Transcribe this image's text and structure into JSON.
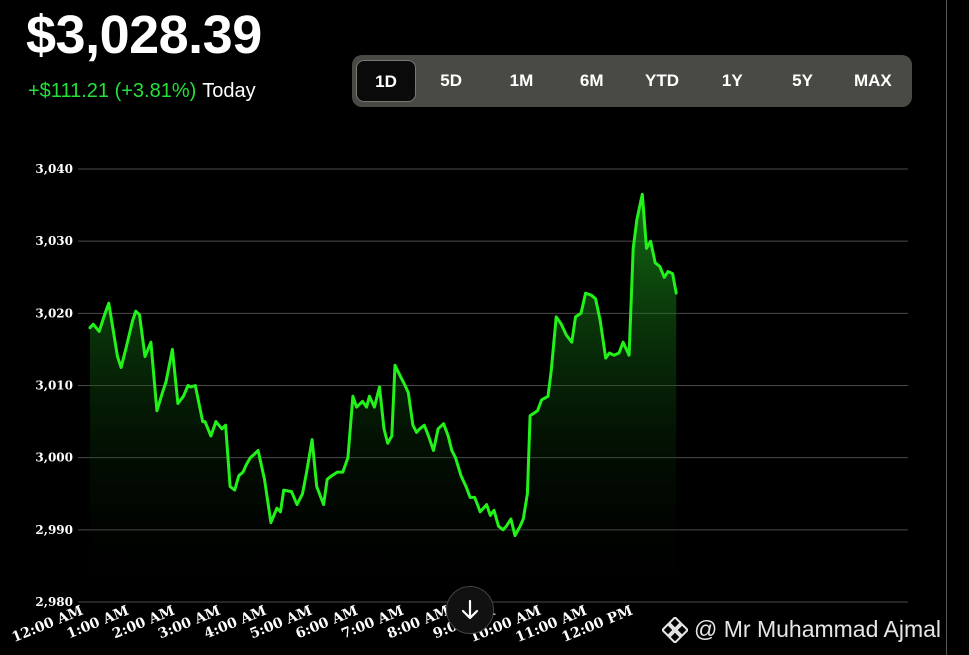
{
  "header": {
    "price": "$3,028.39",
    "change": "+$111.21 (+3.81%)",
    "period_label": "Today"
  },
  "ranges": [
    "1D",
    "5D",
    "1M",
    "6M",
    "YTD",
    "1Y",
    "5Y",
    "MAX"
  ],
  "active_range": "1D",
  "watermark": "@ Mr Muhammad Ajmal",
  "colors": {
    "line": "#22f21a",
    "up": "#22e13a",
    "background": "#000000"
  },
  "icons": {
    "scroll": "arrow-down-icon",
    "brand": "diamond-logo-icon"
  },
  "chart_data": {
    "type": "area",
    "title": "",
    "xlabel": "",
    "ylabel": "",
    "ylim": [
      2980,
      3040
    ],
    "yticks": [
      2980,
      2990,
      3000,
      3010,
      3020,
      3030,
      3040
    ],
    "ytick_labels": [
      "2,980",
      "2,990",
      "3,000",
      "3,010",
      "3,020",
      "3,030",
      "3,040"
    ],
    "xticks": [
      0,
      1,
      2,
      3,
      4,
      5,
      6,
      7,
      8,
      9,
      10,
      11,
      12
    ],
    "xtick_labels": [
      "12:00 AM",
      "1:00 AM",
      "2:00 AM",
      "3:00 AM",
      "4:00 AM",
      "5:00 AM",
      "6:00 AM",
      "7:00 AM",
      "8:00 AM",
      "9:00 AM",
      "10:00 AM",
      "11:00 AM",
      "12:00 PM"
    ],
    "xlim": [
      0,
      12.8
    ],
    "grid": true,
    "series": [
      {
        "x": [
          0,
          0.07,
          0.2,
          0.33,
          0.41,
          0.6,
          0.68,
          0.8,
          0.93,
          1.0,
          1.08,
          1.2,
          1.33,
          1.46,
          1.58,
          1.66,
          1.8,
          1.92,
          2.04,
          2.14,
          2.2,
          2.3,
          2.46,
          2.51,
          2.64,
          2.75,
          2.88,
          2.96,
          3.06,
          3.16,
          3.25,
          3.34,
          3.41,
          3.5,
          3.59,
          3.67,
          3.81,
          3.95,
          4.08,
          4.16,
          4.23,
          4.4,
          4.52,
          4.64,
          4.73,
          4.85,
          4.95,
          5.1,
          5.18,
          5.28,
          5.4,
          5.52,
          5.63,
          5.74,
          5.82,
          5.95,
          6.04,
          6.1,
          6.21,
          6.32,
          6.42,
          6.5,
          6.59,
          6.66,
          6.8,
          6.88,
          6.95,
          7.05,
          7.13,
          7.2,
          7.3,
          7.39,
          7.5,
          7.6,
          7.72,
          7.82,
          7.9,
          7.98,
          8.1,
          8.21,
          8.3,
          8.4,
          8.52,
          8.66,
          8.74,
          8.82,
          8.92,
          9.02,
          9.09,
          9.19,
          9.28,
          9.39,
          9.46,
          9.55,
          9.61,
          9.77,
          9.86,
          10.0,
          10.07,
          10.18,
          10.29,
          10.4,
          10.52,
          10.6,
          10.72,
          10.82,
          10.95,
          11.04,
          11.14,
          11.26,
          11.34,
          11.44,
          11.55,
          11.64,
          11.77,
          11.86,
          11.94,
          12.06,
          12.15,
          12.24,
          12.34,
          12.44,
          12.54,
          12.62,
          12.72,
          12.8
        ],
        "y": [
          3018.0,
          3018.5,
          3017.5,
          3020.0,
          3021.4,
          3014.0,
          3012.5,
          3015.5,
          3019.0,
          3020.3,
          3019.8,
          3014.0,
          3016.0,
          3006.5,
          3009.0,
          3010.5,
          3015.0,
          3007.5,
          3008.5,
          3010.0,
          3009.8,
          3010.0,
          3005.0,
          3005.0,
          3003.0,
          3005.0,
          3004.0,
          3004.5,
          2996.0,
          2995.5,
          2997.5,
          2998.0,
          2999.0,
          3000.0,
          3000.5,
          3001.0,
          2997.0,
          2991.0,
          2993.0,
          2992.5,
          2995.5,
          2995.3,
          2993.5,
          2995.0,
          2998.0,
          3002.5,
          2996.0,
          2993.5,
          2997.0,
          2997.5,
          2998.0,
          2998.0,
          3000.0,
          3008.5,
          3007.0,
          3007.8,
          3007.0,
          3008.5,
          3007.0,
          3009.8,
          3004.0,
          3002.0,
          3003.0,
          3012.8,
          3011.0,
          3010.0,
          3009.0,
          3004.5,
          3003.5,
          3004.0,
          3004.5,
          3003.0,
          3001.0,
          3004.0,
          3004.7,
          3003.0,
          3001.0,
          3000.0,
          2997.5,
          2996.0,
          2994.5,
          2994.5,
          2992.5,
          2993.5,
          2992.0,
          2992.7,
          2990.5,
          2990.0,
          2990.5,
          2991.5,
          2989.2,
          2990.5,
          2991.5,
          2995.0,
          3005.8,
          3006.5,
          3008.0,
          3008.5,
          3012.0,
          3019.5,
          3018.5,
          3017.0,
          3016.0,
          3019.5,
          3020.0,
          3022.8,
          3022.5,
          3022.0,
          3019.0,
          3013.8,
          3014.5,
          3014.2,
          3014.5,
          3016.0,
          3014.2,
          3029.0,
          3033.0,
          3036.5,
          3029.0,
          3030.0,
          3027.0,
          3026.5,
          3025.0,
          3025.8,
          3025.5,
          3022.8
        ]
      }
    ]
  }
}
